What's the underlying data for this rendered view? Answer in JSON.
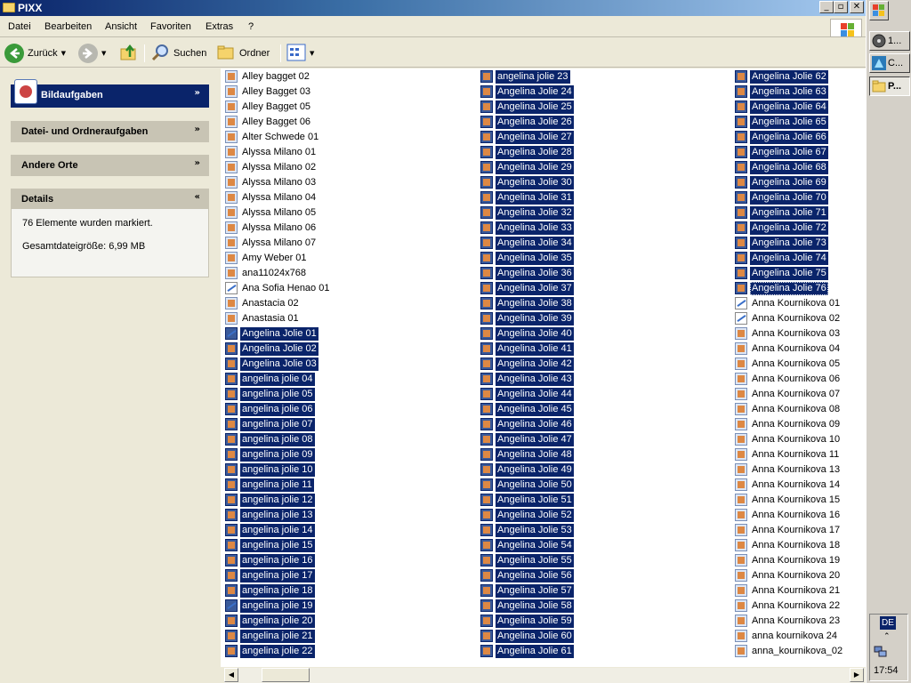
{
  "window": {
    "title": "PIXX",
    "buttons": {
      "minimize": "_",
      "maximize": "▫",
      "close": "✕"
    }
  },
  "menu": [
    "Datei",
    "Bearbeiten",
    "Ansicht",
    "Favoriten",
    "Extras",
    "?"
  ],
  "toolbar": {
    "back_label": "Zurück",
    "search_label": "Suchen",
    "folders_label": "Ordner"
  },
  "taskpane": {
    "image_tasks": "Bildaufgaben",
    "file_folder_tasks": "Datei- und Ordneraufgaben",
    "other_places": "Andere Orte",
    "details": "Details",
    "details_count": "76 Elemente wurden markiert.",
    "details_size": "Gesamtdateigröße: 6,99 MB"
  },
  "files": {
    "col1": [
      {
        "name": "Alley bagget 02",
        "selected": false,
        "icon": "image"
      },
      {
        "name": "Alley Bagget 03",
        "selected": false,
        "icon": "image"
      },
      {
        "name": "Alley Bagget 05",
        "selected": false,
        "icon": "image"
      },
      {
        "name": "Alley Bagget 06",
        "selected": false,
        "icon": "image"
      },
      {
        "name": "Alter Schwede 01",
        "selected": false,
        "icon": "image"
      },
      {
        "name": "Alyssa Milano 01",
        "selected": false,
        "icon": "image"
      },
      {
        "name": "Alyssa Milano 02",
        "selected": false,
        "icon": "image"
      },
      {
        "name": "Alyssa Milano 03",
        "selected": false,
        "icon": "image"
      },
      {
        "name": "Alyssa Milano 04",
        "selected": false,
        "icon": "image"
      },
      {
        "name": "Alyssa Milano 05",
        "selected": false,
        "icon": "image"
      },
      {
        "name": "Alyssa Milano 06",
        "selected": false,
        "icon": "image"
      },
      {
        "name": "Alyssa Milano 07",
        "selected": false,
        "icon": "image"
      },
      {
        "name": "Amy Weber 01",
        "selected": false,
        "icon": "image"
      },
      {
        "name": "ana11024x768",
        "selected": false,
        "icon": "image"
      },
      {
        "name": "Ana Sofia Henao 01",
        "selected": false,
        "icon": "paint"
      },
      {
        "name": "Anastacia 02",
        "selected": false,
        "icon": "image"
      },
      {
        "name": "Anastasia 01",
        "selected": false,
        "icon": "image"
      },
      {
        "name": "Angelina Jolie 01",
        "selected": true,
        "icon": "paint"
      },
      {
        "name": "Angelina Jolie 02",
        "selected": true,
        "icon": "image"
      },
      {
        "name": "Angelina Jolie 03",
        "selected": true,
        "icon": "image"
      },
      {
        "name": "angelina jolie 04",
        "selected": true,
        "icon": "image"
      },
      {
        "name": "angelina jolie 05",
        "selected": true,
        "icon": "image"
      },
      {
        "name": "angelina jolie 06",
        "selected": true,
        "icon": "image"
      },
      {
        "name": "angelina jolie 07",
        "selected": true,
        "icon": "image"
      },
      {
        "name": "angelina jolie 08",
        "selected": true,
        "icon": "image"
      },
      {
        "name": "angelina jolie 09",
        "selected": true,
        "icon": "image"
      },
      {
        "name": "angelina jolie 10",
        "selected": true,
        "icon": "image"
      },
      {
        "name": "angelina jolie 11",
        "selected": true,
        "icon": "image"
      },
      {
        "name": "angelina jolie 12",
        "selected": true,
        "icon": "image"
      },
      {
        "name": "angelina jolie 13",
        "selected": true,
        "icon": "image"
      },
      {
        "name": "angelina jolie 14",
        "selected": true,
        "icon": "image"
      },
      {
        "name": "angelina jolie 15",
        "selected": true,
        "icon": "image"
      },
      {
        "name": "angelina jolie 16",
        "selected": true,
        "icon": "image"
      },
      {
        "name": "angelina jolie 17",
        "selected": true,
        "icon": "image"
      },
      {
        "name": "angelina jolie 18",
        "selected": true,
        "icon": "image"
      },
      {
        "name": "angelina jolie 19",
        "selected": true,
        "icon": "paint"
      },
      {
        "name": "angelina jolie 20",
        "selected": true,
        "icon": "image"
      },
      {
        "name": "angelina jolie 21",
        "selected": true,
        "icon": "image"
      },
      {
        "name": "angelina jolie 22",
        "selected": true,
        "icon": "image"
      }
    ],
    "col2": [
      {
        "name": "angelina jolie 23",
        "selected": true,
        "icon": "image"
      },
      {
        "name": "Angelina Jolie 24",
        "selected": true,
        "icon": "image"
      },
      {
        "name": "Angelina Jolie 25",
        "selected": true,
        "icon": "image"
      },
      {
        "name": "Angelina Jolie 26",
        "selected": true,
        "icon": "image"
      },
      {
        "name": "Angelina Jolie 27",
        "selected": true,
        "icon": "image"
      },
      {
        "name": "Angelina Jolie 28",
        "selected": true,
        "icon": "image"
      },
      {
        "name": "Angelina Jolie 29",
        "selected": true,
        "icon": "image"
      },
      {
        "name": "Angelina Jolie 30",
        "selected": true,
        "icon": "image"
      },
      {
        "name": "Angelina Jolie 31",
        "selected": true,
        "icon": "image"
      },
      {
        "name": "Angelina Jolie 32",
        "selected": true,
        "icon": "image"
      },
      {
        "name": "Angelina Jolie 33",
        "selected": true,
        "icon": "image"
      },
      {
        "name": "Angelina Jolie 34",
        "selected": true,
        "icon": "image"
      },
      {
        "name": "Angelina Jolie 35",
        "selected": true,
        "icon": "image"
      },
      {
        "name": "Angelina Jolie 36",
        "selected": true,
        "icon": "image"
      },
      {
        "name": "Angelina Jolie 37",
        "selected": true,
        "icon": "image"
      },
      {
        "name": "Angelina Jolie 38",
        "selected": true,
        "icon": "image"
      },
      {
        "name": "Angelina Jolie 39",
        "selected": true,
        "icon": "image"
      },
      {
        "name": "Angelina Jolie 40",
        "selected": true,
        "icon": "image"
      },
      {
        "name": "Angelina Jolie 41",
        "selected": true,
        "icon": "image"
      },
      {
        "name": "Angelina Jolie 42",
        "selected": true,
        "icon": "image"
      },
      {
        "name": "Angelina Jolie 43",
        "selected": true,
        "icon": "image"
      },
      {
        "name": "Angelina Jolie 44",
        "selected": true,
        "icon": "image"
      },
      {
        "name": "Angelina Jolie 45",
        "selected": true,
        "icon": "image"
      },
      {
        "name": "Angelina Jolie 46",
        "selected": true,
        "icon": "image"
      },
      {
        "name": "Angelina Jolie 47",
        "selected": true,
        "icon": "image"
      },
      {
        "name": "Angelina Jolie 48",
        "selected": true,
        "icon": "image"
      },
      {
        "name": "Angelina Jolie 49",
        "selected": true,
        "icon": "image"
      },
      {
        "name": "Angelina Jolie 50",
        "selected": true,
        "icon": "image"
      },
      {
        "name": "Angelina Jolie 51",
        "selected": true,
        "icon": "image"
      },
      {
        "name": "Angelina Jolie 52",
        "selected": true,
        "icon": "image"
      },
      {
        "name": "Angelina Jolie 53",
        "selected": true,
        "icon": "image"
      },
      {
        "name": "Angelina Jolie 54",
        "selected": true,
        "icon": "image"
      },
      {
        "name": "Angelina Jolie 55",
        "selected": true,
        "icon": "image"
      },
      {
        "name": "Angelina Jolie 56",
        "selected": true,
        "icon": "image"
      },
      {
        "name": "Angelina Jolie 57",
        "selected": true,
        "icon": "image"
      },
      {
        "name": "Angelina Jolie 58",
        "selected": true,
        "icon": "image"
      },
      {
        "name": "Angelina Jolie 59",
        "selected": true,
        "icon": "image"
      },
      {
        "name": "Angelina Jolie 60",
        "selected": true,
        "icon": "image"
      },
      {
        "name": "Angelina Jolie 61",
        "selected": true,
        "icon": "image"
      }
    ],
    "col3": [
      {
        "name": "Angelina Jolie 62",
        "selected": true,
        "icon": "image"
      },
      {
        "name": "Angelina Jolie 63",
        "selected": true,
        "icon": "image"
      },
      {
        "name": "Angelina Jolie 64",
        "selected": true,
        "icon": "image"
      },
      {
        "name": "Angelina Jolie 65",
        "selected": true,
        "icon": "image"
      },
      {
        "name": "Angelina Jolie 66",
        "selected": true,
        "icon": "image"
      },
      {
        "name": "Angelina Jolie 67",
        "selected": true,
        "icon": "image"
      },
      {
        "name": "Angelina Jolie 68",
        "selected": true,
        "icon": "image"
      },
      {
        "name": "Angelina Jolie 69",
        "selected": true,
        "icon": "image"
      },
      {
        "name": "Angelina Jolie 70",
        "selected": true,
        "icon": "image"
      },
      {
        "name": "Angelina Jolie 71",
        "selected": true,
        "icon": "image"
      },
      {
        "name": "Angelina Jolie 72",
        "selected": true,
        "icon": "image"
      },
      {
        "name": "Angelina Jolie 73",
        "selected": true,
        "icon": "image"
      },
      {
        "name": "Angelina Jolie 74",
        "selected": true,
        "icon": "image"
      },
      {
        "name": "Angelina Jolie 75",
        "selected": true,
        "icon": "image"
      },
      {
        "name": "Angelina Jolie 76",
        "selected": true,
        "focused": true,
        "icon": "image"
      },
      {
        "name": "Anna Kournikova 01",
        "selected": false,
        "icon": "paint"
      },
      {
        "name": "Anna Kournikova 02",
        "selected": false,
        "icon": "paint"
      },
      {
        "name": "Anna Kournikova 03",
        "selected": false,
        "icon": "image"
      },
      {
        "name": "Anna Kournikova 04",
        "selected": false,
        "icon": "image"
      },
      {
        "name": "Anna Kournikova 05",
        "selected": false,
        "icon": "image"
      },
      {
        "name": "Anna Kournikova 06",
        "selected": false,
        "icon": "image"
      },
      {
        "name": "Anna Kournikova 07",
        "selected": false,
        "icon": "image"
      },
      {
        "name": "Anna Kournikova 08",
        "selected": false,
        "icon": "image"
      },
      {
        "name": "Anna Kournikova 09",
        "selected": false,
        "icon": "image"
      },
      {
        "name": "Anna Kournikova 10",
        "selected": false,
        "icon": "image"
      },
      {
        "name": "Anna Kournikova 11",
        "selected": false,
        "icon": "image"
      },
      {
        "name": "Anna Kournikova 13",
        "selected": false,
        "icon": "image"
      },
      {
        "name": "Anna Kournikova 14",
        "selected": false,
        "icon": "image"
      },
      {
        "name": "Anna Kournikova 15",
        "selected": false,
        "icon": "image"
      },
      {
        "name": "Anna Kournikova 16",
        "selected": false,
        "icon": "image"
      },
      {
        "name": "Anna Kournikova 17",
        "selected": false,
        "icon": "image"
      },
      {
        "name": "Anna Kournikova 18",
        "selected": false,
        "icon": "image"
      },
      {
        "name": "Anna Kournikova 19",
        "selected": false,
        "icon": "image"
      },
      {
        "name": "Anna Kournikova 20",
        "selected": false,
        "icon": "image"
      },
      {
        "name": "Anna Kournikova 21",
        "selected": false,
        "icon": "image"
      },
      {
        "name": "Anna Kournikova 22",
        "selected": false,
        "icon": "image"
      },
      {
        "name": "Anna Kournikova 23",
        "selected": false,
        "icon": "image"
      },
      {
        "name": "anna kournikova 24",
        "selected": false,
        "icon": "image"
      },
      {
        "name": "anna_kournikova_02",
        "selected": false,
        "icon": "image"
      }
    ]
  },
  "taskbar": {
    "buttons": [
      {
        "label": "1...",
        "active": false
      },
      {
        "label": "C...",
        "active": false
      },
      {
        "label": "P...",
        "active": true
      }
    ],
    "language": "DE",
    "clock": "17:54"
  },
  "colors": {
    "selection": "#0a246a",
    "titlebar": "#0a246a",
    "face": "#ece9d8"
  }
}
